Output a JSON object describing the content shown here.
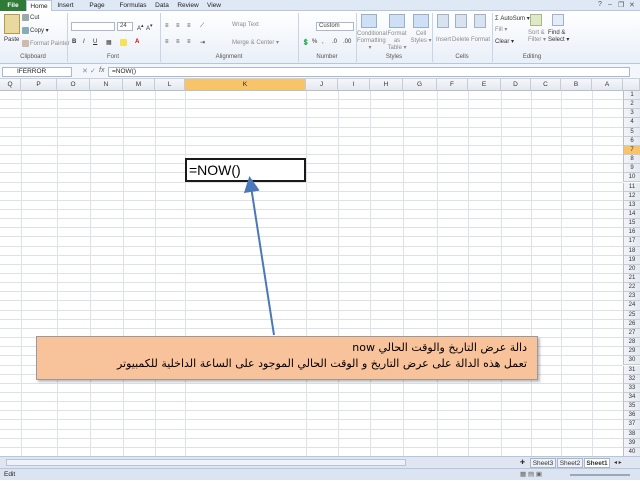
{
  "tabs": [
    "File",
    "Home",
    "Insert",
    "Page Layout",
    "Formulas",
    "Data",
    "Review",
    "View"
  ],
  "ribbon": {
    "clipboard": {
      "paste": "Paste",
      "cut": "Cut",
      "copy": "Copy ▾",
      "format_painter": "Format Painter",
      "label": "Clipboard"
    },
    "font": {
      "size": "24",
      "label": "Font",
      "bold": "B",
      "italic": "I",
      "underline": "U"
    },
    "alignment": {
      "wrap": "Wrap Text",
      "merge": "Merge & Center ▾",
      "label": "Alignment"
    },
    "number": {
      "format": "Custom",
      "percent": "%",
      "comma": ",",
      "label": "Number"
    },
    "styles": {
      "conditional": "Conditional Formatting ▾",
      "format_table": "Format as Table ▾",
      "cell_styles": "Cell Styles ▾",
      "label": "Styles"
    },
    "cells": {
      "insert": "Insert",
      "delete": "Delete",
      "format": "Format",
      "label": "Cells"
    },
    "editing": {
      "autosum": "Σ AutoSum ▾",
      "fill": "Fill ▾",
      "clear": "Clear ▾",
      "sort": "Sort & Filter ▾",
      "find": "Find & Select ▾",
      "label": "Editing"
    }
  },
  "formula_bar": {
    "name_box": "IFERROR",
    "fx": "fx",
    "formula": "=NOW()"
  },
  "columns": [
    "Q",
    "P",
    "O",
    "N",
    "M",
    "L",
    "K",
    "J",
    "I",
    "H",
    "G",
    "F",
    "E",
    "D",
    "C",
    "B",
    "A"
  ],
  "selected_column": "K",
  "rows": [
    "1",
    "2",
    "3",
    "4",
    "5",
    "6",
    "7",
    "8",
    "9",
    "10",
    "11",
    "12",
    "13",
    "14",
    "15",
    "16",
    "17",
    "18",
    "19",
    "20",
    "21",
    "22",
    "23",
    "24",
    "25",
    "26",
    "27",
    "28",
    "29",
    "30",
    "31",
    "32",
    "33",
    "34",
    "35",
    "36",
    "37",
    "38",
    "39",
    "40"
  ],
  "selected_row": "7",
  "active_cell": {
    "value": "=NOW()"
  },
  "callout": {
    "line1": "دالة عرض التاريخ والوقت الحالي now",
    "line2": "تعمل هذه الدالة على عرض التاريخ و الوقت الحالي الموجود على الساعة الداخلية للكمبيوتر"
  },
  "sheets": [
    "Sheet3",
    "Sheet2",
    "Sheet1"
  ],
  "active_sheet": "Sheet1",
  "status": {
    "ready": "Edit"
  },
  "colors": {
    "file_tab": "#2f7a37",
    "selected_header": "#f8c46a",
    "callout_fill": "#f8c29a",
    "arrow": "#4a78b8"
  }
}
